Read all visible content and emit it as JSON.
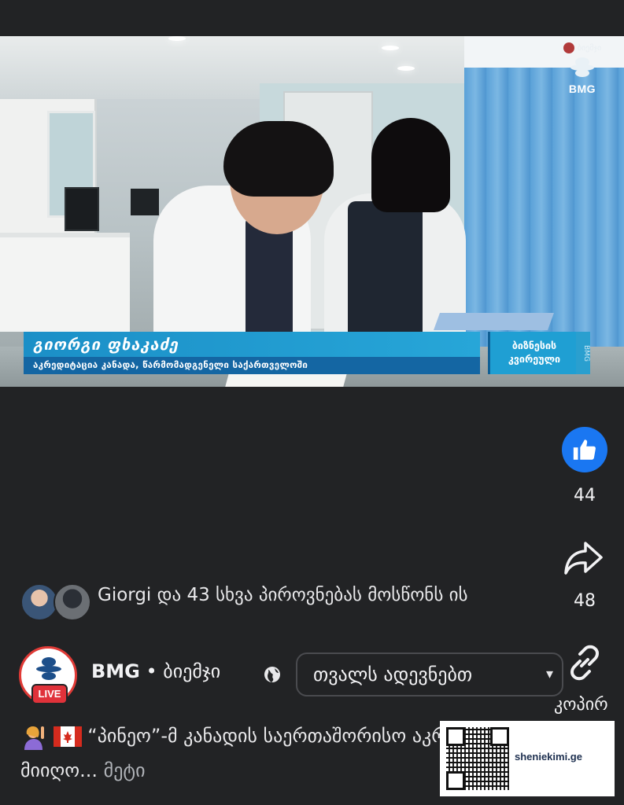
{
  "video": {
    "watermark": {
      "top_text": "ბიემჯი",
      "brand": "BMG"
    },
    "lower_third": {
      "name": "გიორგი ფხაკაძე",
      "subtitle": "აკრედიტაცია კანადა, წარმომადგენელი საქართველოში",
      "show_line1": "ბიზნესის",
      "show_line2": "კვირეული",
      "show_badge": "BMG"
    }
  },
  "actions": {
    "like_count": "44",
    "share_count": "48",
    "copy_label": "კოპირ",
    "like_icon": "thumbs-up-icon",
    "share_icon": "share-arrow-icon",
    "copy_icon": "link-icon"
  },
  "reactions": {
    "text": "Giorgi და 43 სხვა პიროვნებას მოსწონს ის"
  },
  "page": {
    "name": "BMG",
    "separator": " • ",
    "alt_name": "ბიემჯი",
    "live_badge": "LIVE",
    "avatar_text": "BMG",
    "follow_label": "თვალს ადევნებთ"
  },
  "caption": {
    "text": "“პინეო”-მ კანადის საერთაშორისო აკრედიტაცია მიიღო...",
    "more": "მეტი"
  },
  "qr_overlay": {
    "label": "sheniekimi.ge"
  },
  "colors": {
    "background": "#222325",
    "like_blue": "#1a77f2",
    "live_red": "#e0323a",
    "lower_third_blue": "#1b8fc7"
  }
}
